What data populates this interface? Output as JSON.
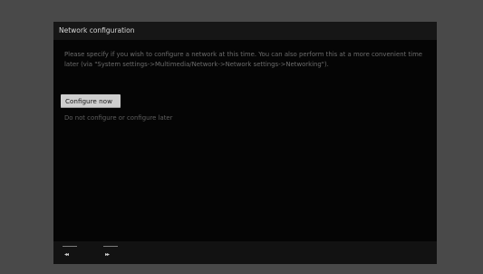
{
  "dialog": {
    "title": "Network configuration",
    "description": "Please specify if you wish to configure a network at this time. You can also perform this at a more convenient time later (via \"System settings->Multimedia/Network->Network settings->Networking\").",
    "configure_now_label": "Configure now",
    "configure_later_label": "Do not configure or configure later"
  },
  "navigation": {
    "back_glyph": "◂◂",
    "forward_glyph": "▸▸"
  }
}
